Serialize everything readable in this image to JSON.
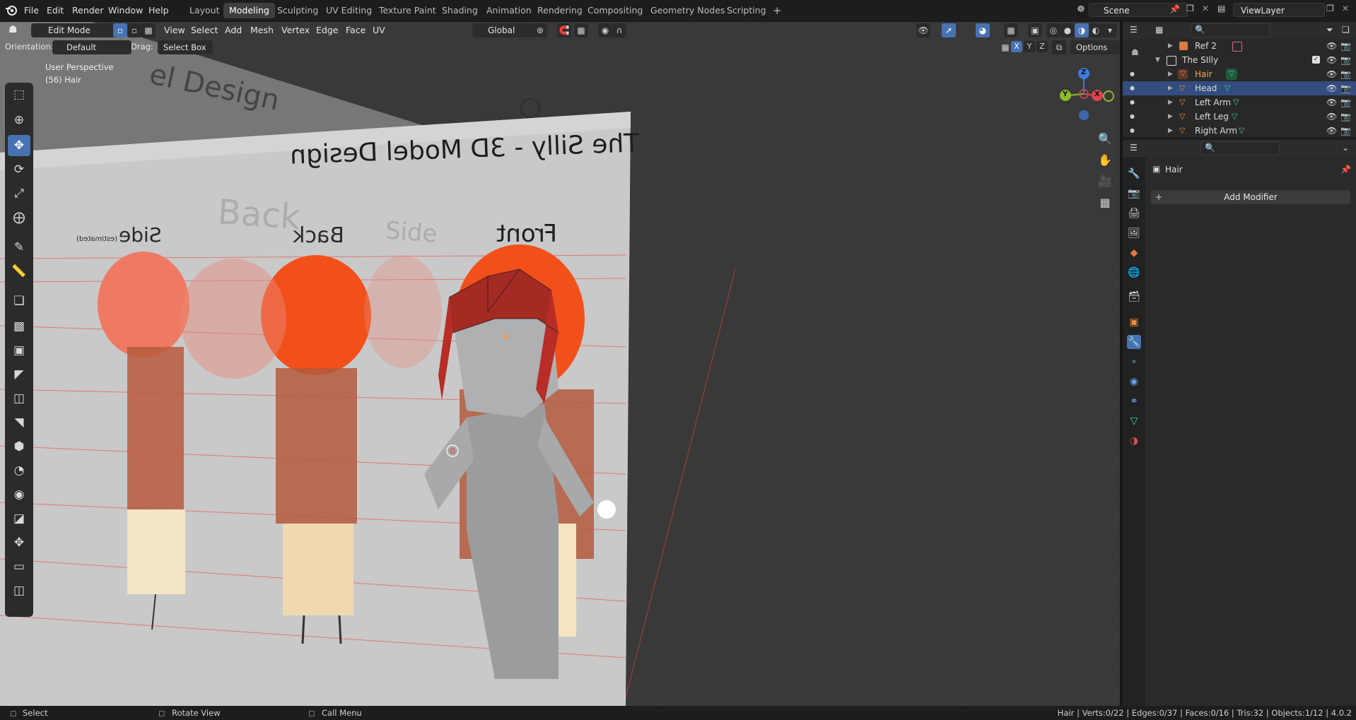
{
  "menubar": {
    "items": [
      "File",
      "Edit",
      "Render",
      "Window",
      "Help"
    ],
    "workspaces": [
      "Layout",
      "Modeling",
      "Sculpting",
      "UV Editing",
      "Texture Paint",
      "Shading",
      "Animation",
      "Rendering",
      "Compositing",
      "Geometry Nodes",
      "Scripting"
    ],
    "active_workspace": "Modeling",
    "add_tab": "+",
    "scene_label": "Scene",
    "viewlayer_label": "ViewLayer"
  },
  "viewport_header": {
    "mode": "Edit Mode",
    "menus": [
      "View",
      "Select",
      "Add",
      "Mesh",
      "Vertex",
      "Edge",
      "Face",
      "UV"
    ],
    "transform_orientation": "Global",
    "orientation_label": "Orientation:",
    "orientation_value": "Default",
    "drag_label": "Drag:",
    "drag_value": "Select Box",
    "axis_x": "X",
    "axis_y": "Y",
    "axis_z": "Z",
    "options_label": "Options"
  },
  "viewport": {
    "perspective_label": "User Perspective",
    "object_label": "(56) Hair",
    "image_title": "The Silly - 3D Model Design",
    "image_top_title": "el Design",
    "view_front": "Front",
    "view_back": "Back",
    "view_side": "Side",
    "view_side_note": "(estimated)",
    "ghost_back": "Back",
    "ghost_side": "Side",
    "gizmo_z": "Z",
    "gizmo_y": "Y",
    "gizmo_x": "X"
  },
  "outliner": {
    "rows": [
      {
        "name": "Ref 2",
        "indent": 1,
        "selected": false,
        "type": "image"
      },
      {
        "name": "The SIlly",
        "indent": 0,
        "selected": false,
        "type": "collection"
      },
      {
        "name": "Hair",
        "indent": 1,
        "selected": false,
        "type": "mesh",
        "active": true
      },
      {
        "name": "Head",
        "indent": 1,
        "selected": true,
        "type": "mesh"
      },
      {
        "name": "Left Arm",
        "indent": 1,
        "selected": false,
        "type": "mesh"
      },
      {
        "name": "Left Leg",
        "indent": 1,
        "selected": false,
        "type": "mesh"
      },
      {
        "name": "Right Arm",
        "indent": 1,
        "selected": false,
        "type": "mesh"
      }
    ]
  },
  "properties": {
    "object_name": "Hair",
    "add_modifier_label": "Add Modifier"
  },
  "statusbar": {
    "left_select": "Select",
    "rotate_view": "Rotate View",
    "call_menu": "Call Menu",
    "stats": "Hair | Verts:0/22 | Edges:0/37 | Faces:0/16 | Tris:32 | Objects:1/12 | 4.0.2"
  },
  "colors": {
    "accent_blue": "#4772b3",
    "hair_orange": "#e8531f",
    "axis_red": "#e0454a",
    "axis_green": "#8bbc2a",
    "axis_blue": "#3c7be0"
  }
}
